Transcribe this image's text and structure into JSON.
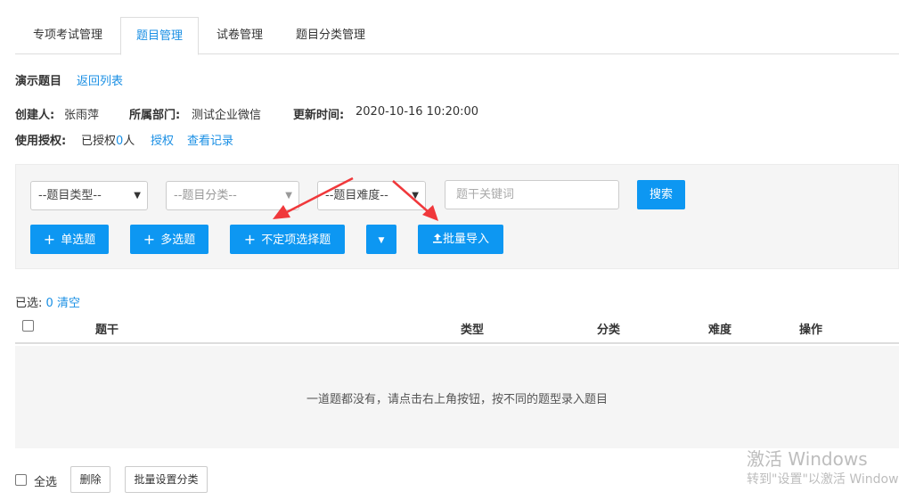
{
  "tabs": [
    {
      "label": "专项考试管理"
    },
    {
      "label": "题目管理",
      "active": true
    },
    {
      "label": "试卷管理"
    },
    {
      "label": "题目分类管理"
    }
  ],
  "header": {
    "title": "演示题目",
    "back_link": "返回列表"
  },
  "meta": {
    "creator_label": "创建人:",
    "creator_value": "张雨萍",
    "dept_label": "所属部门:",
    "dept_value": "测试企业微信",
    "updated_label": "更新时间:",
    "updated_value": "2020-10-16 10:20:00",
    "auth_label": "使用授权:",
    "auth_prefix": "已授权",
    "auth_count": "0",
    "auth_suffix": "人",
    "auth_link": "授权",
    "log_link": "查看记录"
  },
  "filters": {
    "type_select": "--题目类型--",
    "category_select": "--题目分类--",
    "difficulty_select": "--题目难度--",
    "keyword_placeholder": "题干关键词",
    "search_button": "搜索"
  },
  "actions": {
    "single_choice": "单选题",
    "multi_choice": "多选题",
    "indefinite_choice": "不定项选择题",
    "batch_import": "批量导入"
  },
  "selection": {
    "label": "已选:",
    "count": "0",
    "clear": "清空"
  },
  "table": {
    "columns": [
      "题干",
      "类型",
      "分类",
      "难度",
      "操作"
    ],
    "empty_text": "一道题都没有，请点击右上角按钮，按不同的题型录入题目"
  },
  "footer": {
    "select_all": "全选",
    "delete": "删除",
    "batch_category": "批量设置分类"
  },
  "watermark": {
    "line1": "激活 Windows",
    "line2": "转到\"设置\"以激活 Windows。"
  },
  "colors": {
    "primary": "#0d97f2",
    "link": "#1a8fe4",
    "annotation_arrow": "#f0383b"
  }
}
